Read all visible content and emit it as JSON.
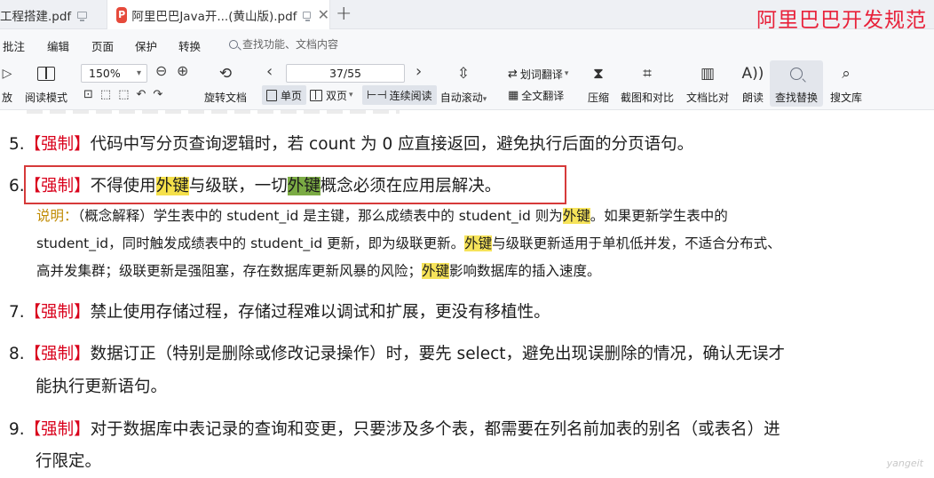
{
  "tabs": [
    {
      "label": "工程搭建.pdf"
    },
    {
      "label": "阿里巴巴Java开...(黄山版).pdf",
      "logo": "P"
    }
  ],
  "overlay_title": "阿里巴巴开发规范",
  "menu": {
    "items": [
      "批注",
      "编辑",
      "页面",
      "保护",
      "转换"
    ],
    "search_placeholder": "查找功能、文档内容"
  },
  "toolbar": {
    "play_label": "放",
    "reading_mode": "阅读模式",
    "zoom": "150%",
    "page": "37/55",
    "rotate": "旋转文档",
    "single_page": "单页",
    "double_page": "双页",
    "continuous": "连续阅读",
    "auto_scroll": "自动滚动",
    "word_translate": "划词翻译",
    "full_translate": "全文翻译",
    "compress": "压缩",
    "screenshot_compare": "截图和对比",
    "doc_compare": "文档比对",
    "read_aloud": "朗读",
    "find_replace": "查找替换",
    "search_lib": "搜文库"
  },
  "doc": {
    "item5": {
      "num": "5.",
      "tag": "【强制】",
      "text": "代码中写分页查询逻辑时，若 count 为 0 应直接返回，避免执行后面的分页语句。"
    },
    "item6": {
      "num": "6.",
      "tag": "【强制】",
      "t1": "不得使用",
      "hl1": "外键",
      "t2": "与级联，一切",
      "hl2": "外键",
      "t3": "概念必须在应用层解决。"
    },
    "note": {
      "label": "说明：",
      "l1a": "（概念解释）学生表中的 student_id 是主键，那么成绩表中的 student_id 则为",
      "l1hl": "外键",
      "l1b": "。如果更新学生表中的",
      "l2a": "student_id，同时触发成绩表中的 student_id 更新，即为级联更新。",
      "l2hl": "外键",
      "l2b": "与级联更新适用于单机低并发，不适合分布式、",
      "l3a": "高并发集群；级联更新是强阻塞，存在数据库更新风暴的风险；",
      "l3hl": "外键",
      "l3b": "影响数据库的插入速度。"
    },
    "item7": {
      "num": "7.",
      "tag": "【强制】",
      "text": "禁止使用存储过程，存储过程难以调试和扩展，更没有移植性。"
    },
    "item8": {
      "num": "8.",
      "tag": "【强制】",
      "text": "数据订正（特别是删除或修改记录操作）时，要先 select，避免出现误删除的情况，确认无误才",
      "cont": "能执行更新语句。"
    },
    "item9": {
      "num": "9.",
      "tag": "【强制】",
      "text": "对于数据库中表记录的查询和变更，只要涉及多个表，都需要在列名前加表的别名（或表名）进",
      "cont": "行限定。"
    }
  },
  "watermark": "yangeit",
  "colors": {
    "tag_red": "#d9001b",
    "highlight_yellow": "#f5e04a",
    "highlight_green": "#7bab44",
    "box_red": "#d63a3a",
    "overlay_red": "#e8213a"
  }
}
